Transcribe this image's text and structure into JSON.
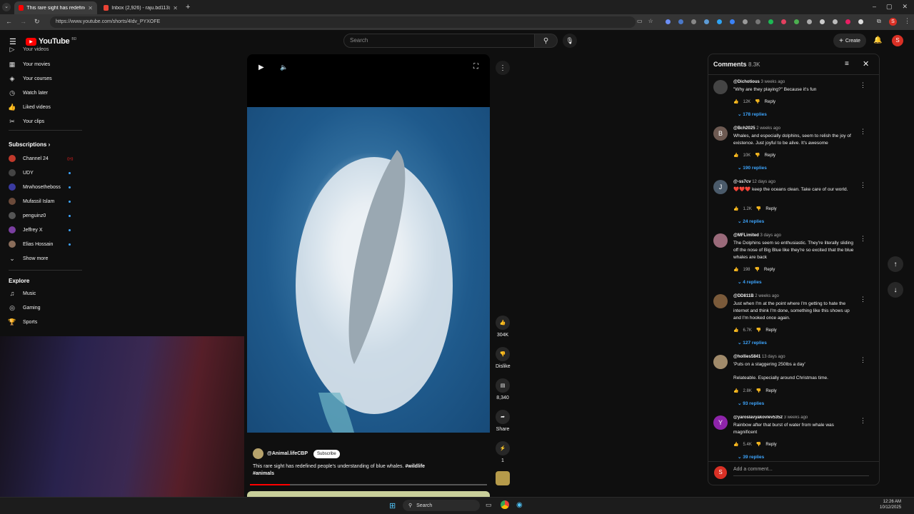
{
  "browser": {
    "tab1": "This rare sight has redefined pe",
    "tab2": "Inbox (2,926) - raju.bd113@gm",
    "url": "https://www.youtube.com/shorts/4Idv_PYXOFE"
  },
  "yt": {
    "logo": "YouTube",
    "logo_sup": "BD",
    "search_placeholder": "Search",
    "create": "Create",
    "user_initial": "S"
  },
  "sidebar": {
    "top_item": "Your videos",
    "items": [
      "Your movies",
      "Your courses",
      "Watch later",
      "Liked videos",
      "Your clips"
    ],
    "subs_header": "Subscriptions",
    "subs": [
      "Channel 24",
      "UDY",
      "Mrwhosetheboss",
      "Mufassil Islam",
      "penguinz0",
      "Jeffrey X",
      "Elias Hossain"
    ],
    "show_more": "Show more",
    "explore_header": "Explore",
    "explore": [
      "Music",
      "Gaming",
      "Sports"
    ]
  },
  "video": {
    "channel": "@Animal.lifeCBP",
    "subscribe": "Subscribe",
    "caption": "This rare sight has redefined people's understanding of blue whales.",
    "tag1": "#wildlife",
    "tag2": "#animals",
    "likes": "304K",
    "dislike": "Dislike",
    "comments_count": "8,340",
    "share": "Share",
    "remix": "1"
  },
  "comments": {
    "title": "Comments",
    "count": "8.3K",
    "add": "Add a comment...",
    "reply": "Reply",
    "items": [
      {
        "user": "@Dichotious",
        "when": "3 weeks ago",
        "text": "\"Why are they playing?\" Because it's fun",
        "likes": "12K",
        "replies": "178 replies"
      },
      {
        "user": "@Bch2025",
        "when": "2 weeks ago",
        "text": "Whales, and especially dolphins, seem to relish the joy of existence.  Just joyful to be alive.  It's awesome",
        "likes": "10K",
        "replies": "190 replies",
        "initial": "B"
      },
      {
        "user": "@-ss7cv",
        "when": "12 days ago",
        "text": "❤️❤️❤️ keep the oceans clean. Take care of our world.",
        "likes": "1.2K",
        "replies": "24 replies",
        "initial": "J"
      },
      {
        "user": "@MFLimited",
        "when": "3 days ago",
        "text": "The Dolphins seem so enthusiastic. They're literally sliding off the nose of Big Blue like they're so excited that the blue whales are back",
        "likes": "198",
        "replies": "4 replies"
      },
      {
        "user": "@DD811B",
        "when": "2 weeks ago",
        "text": "Just when I'm at the point where I'm getting to hate the internet and think I'm done, something like this shows up and I'm hooked once again.",
        "likes": "6.7K",
        "replies": "127 replies"
      },
      {
        "user": "@hollies5841",
        "when": "13 days ago",
        "text": "'Puts on a staggering 250lbs a day'",
        "text2": "Relateable.  Especially around Christmas time.",
        "likes": "2.8K",
        "replies": "93 replies"
      },
      {
        "user": "@yaroslavyakovlev5352",
        "when": "3 weeks ago",
        "text": "Rainbow after that burst of water from whale was magnificent",
        "likes": "5.4K",
        "replies": "39 replies",
        "initial": "Y"
      }
    ]
  },
  "taskbar": {
    "search": "Search",
    "time": "12:26 AM",
    "date": "10/12/2025"
  }
}
